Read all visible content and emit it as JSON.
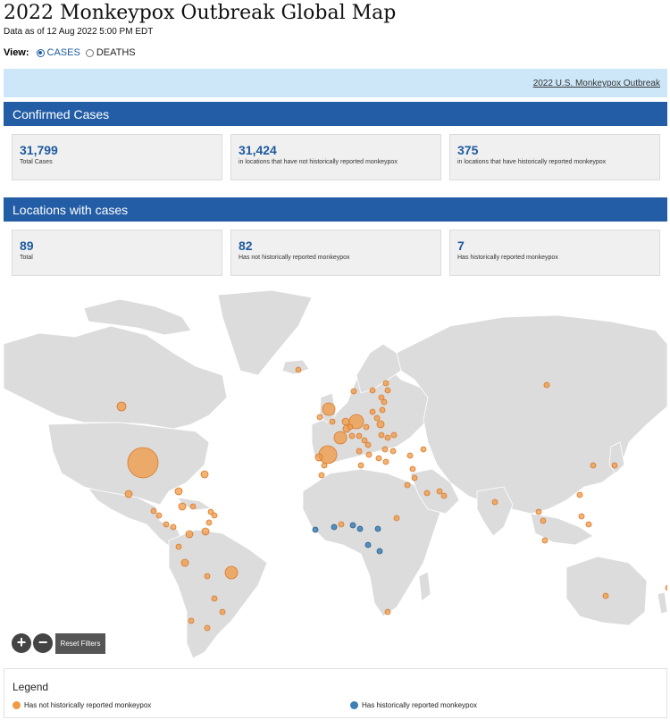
{
  "header": {
    "title": "2022 Monkeypox Outbreak Global Map",
    "as_of": "Data as of 12 Aug 2022 5:00 PM EDT"
  },
  "view": {
    "label": "View:",
    "options": [
      "CASES",
      "DEATHS"
    ],
    "selected": "CASES"
  },
  "banner": {
    "link": "2022 U.S. Monkeypox Outbreak"
  },
  "confirmed": {
    "heading": "Confirmed Cases",
    "stats": [
      {
        "value": "31,799",
        "label": "Total Cases"
      },
      {
        "value": "31,424",
        "label": "in locations that have not historically reported monkeypox"
      },
      {
        "value": "375",
        "label": "in locations that have historically reported monkeypox"
      }
    ]
  },
  "locations": {
    "heading": "Locations with cases",
    "stats": [
      {
        "value": "89",
        "label": "Total"
      },
      {
        "value": "82",
        "label": "Has not historically reported monkeypox"
      },
      {
        "value": "7",
        "label": "Has historically reported monkeypox"
      }
    ]
  },
  "map": {
    "zoom_in": "+",
    "zoom_out": "−",
    "reset": "Reset Filters",
    "colors": {
      "not_historical": "#f09a44",
      "historical": "#3d7fb5",
      "land": "#dcdcdc",
      "border": "#ffffff"
    }
  },
  "legend": {
    "title": "Legend",
    "items": [
      {
        "label": "Has not historically reported monkeypox",
        "color": "#f09a44"
      },
      {
        "label": "Has historically reported monkeypox",
        "color": "#3d7fb5"
      }
    ]
  }
}
